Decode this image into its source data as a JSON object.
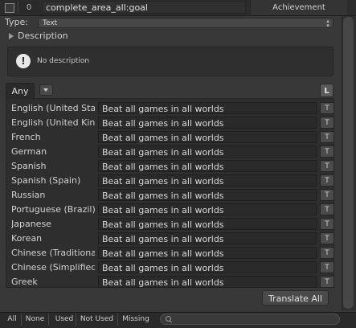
{
  "header": {
    "index": "0",
    "key": "complete_area_all:goal",
    "category": "Achievement"
  },
  "type": {
    "label": "Type:",
    "value": "Text"
  },
  "description": {
    "label": "Description",
    "info_text": "No description"
  },
  "filter": {
    "tab_label": "Any",
    "lock_label": "L"
  },
  "translations": [
    {
      "language": "English (United States)",
      "text": "Beat all games in all worlds",
      "button": "T"
    },
    {
      "language": "English (United Kingdom)",
      "text": "Beat all games in all worlds",
      "button": "T"
    },
    {
      "language": "French",
      "text": "Beat all games in all worlds",
      "button": "T"
    },
    {
      "language": "German",
      "text": "Beat all games in all worlds",
      "button": "T"
    },
    {
      "language": "Spanish",
      "text": "Beat all games in all worlds",
      "button": "T"
    },
    {
      "language": "Spanish (Spain)",
      "text": "Beat all games in all worlds",
      "button": "T"
    },
    {
      "language": "Russian",
      "text": "Beat all games in all worlds",
      "button": "T"
    },
    {
      "language": "Portuguese (Brazil)",
      "text": "Beat all games in all worlds",
      "button": "T"
    },
    {
      "language": "Japanese",
      "text": "Beat all games in all worlds",
      "button": "T"
    },
    {
      "language": "Korean",
      "text": "Beat all games in all worlds",
      "button": "T"
    },
    {
      "language": "Chinese (Traditional)",
      "text": "Beat all games in all worlds",
      "button": "T"
    },
    {
      "language": "Chinese (Simplified)",
      "text": "Beat all games in all worlds",
      "button": "T"
    },
    {
      "language": "Greek",
      "text": "Beat all games in all worlds",
      "button": "T"
    }
  ],
  "actions": {
    "translate_all": "Translate All"
  },
  "bottom_filters": [
    "All",
    "None",
    "Used",
    "Not Used",
    "Missing"
  ],
  "icons": {
    "info": "exclamation-icon",
    "foldout": "triangle-right-icon",
    "dropdown": "chevron-down-icon",
    "search": "search-icon"
  }
}
